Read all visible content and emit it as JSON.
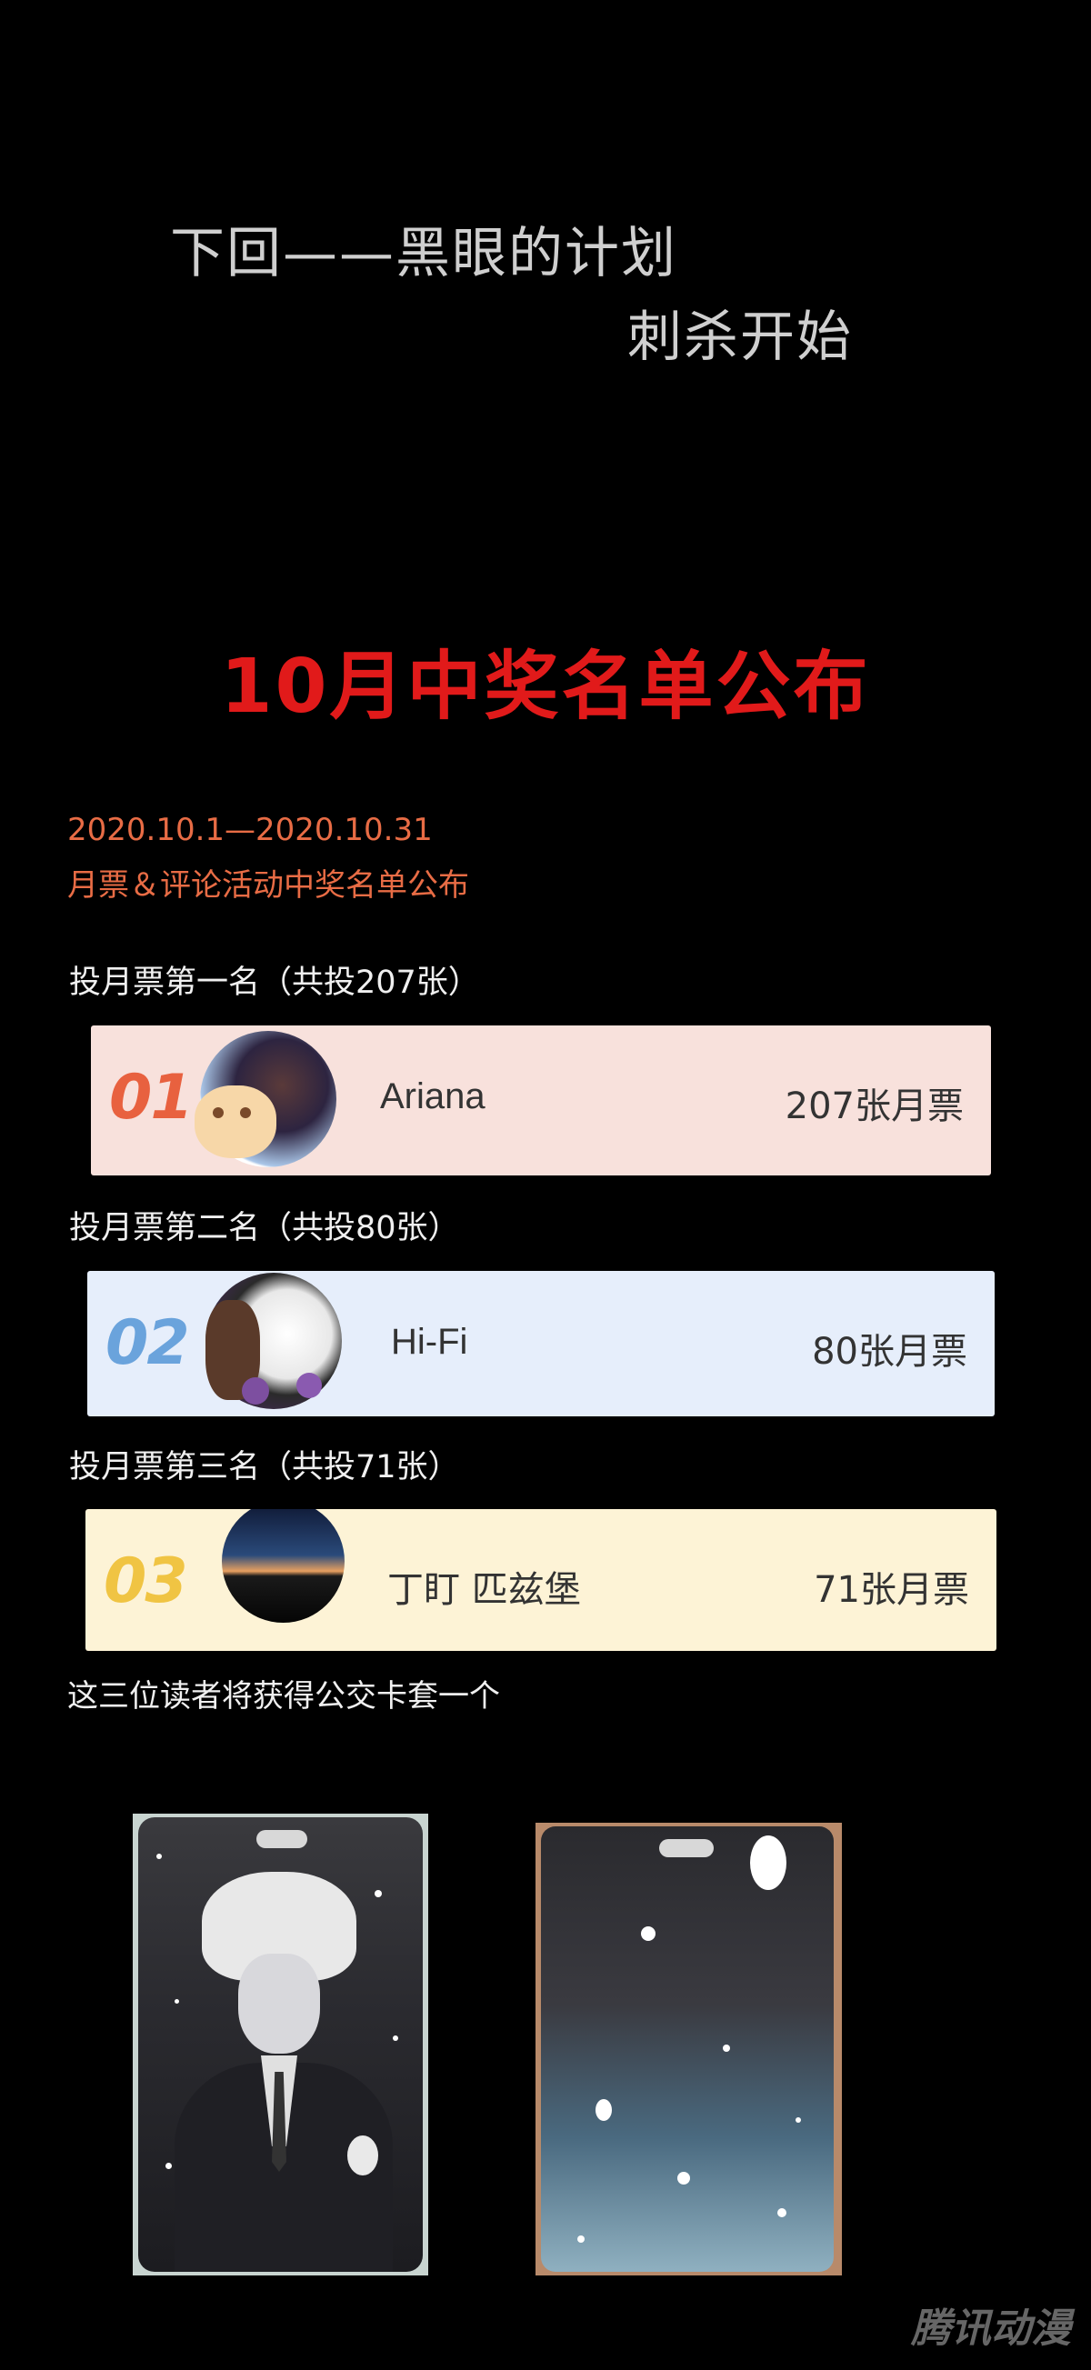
{
  "preview": {
    "line1": "下回——黑眼的计划",
    "line2": "刺杀开始"
  },
  "announcement": {
    "title": "10月中奖名单公布",
    "date_range": "2020.10.1—2020.10.31",
    "subtitle": "月票＆评论活动中奖名单公布"
  },
  "winners": [
    {
      "section_title": "投月票第一名（共投207张）",
      "rank": "01",
      "username": "Ariana",
      "votes": "207张月票",
      "card_color": "#f8e1dc",
      "rank_color": "#e8613f"
    },
    {
      "section_title": "投月票第二名（共投80张）",
      "rank": "02",
      "username": "Hi-Fi",
      "votes": "80张月票",
      "card_color": "#e6eefb",
      "rank_color": "#6aa3dc"
    },
    {
      "section_title": "投月票第三名（共投71张）",
      "rank": "03",
      "username": "丁盯 匹兹堡",
      "votes": "71张月票",
      "card_color": "#fdf3d6",
      "rank_color": "#f0c443"
    }
  ],
  "prize": {
    "text": "这三位读者将获得公交卡套一个"
  },
  "watermark": "腾讯动漫"
}
